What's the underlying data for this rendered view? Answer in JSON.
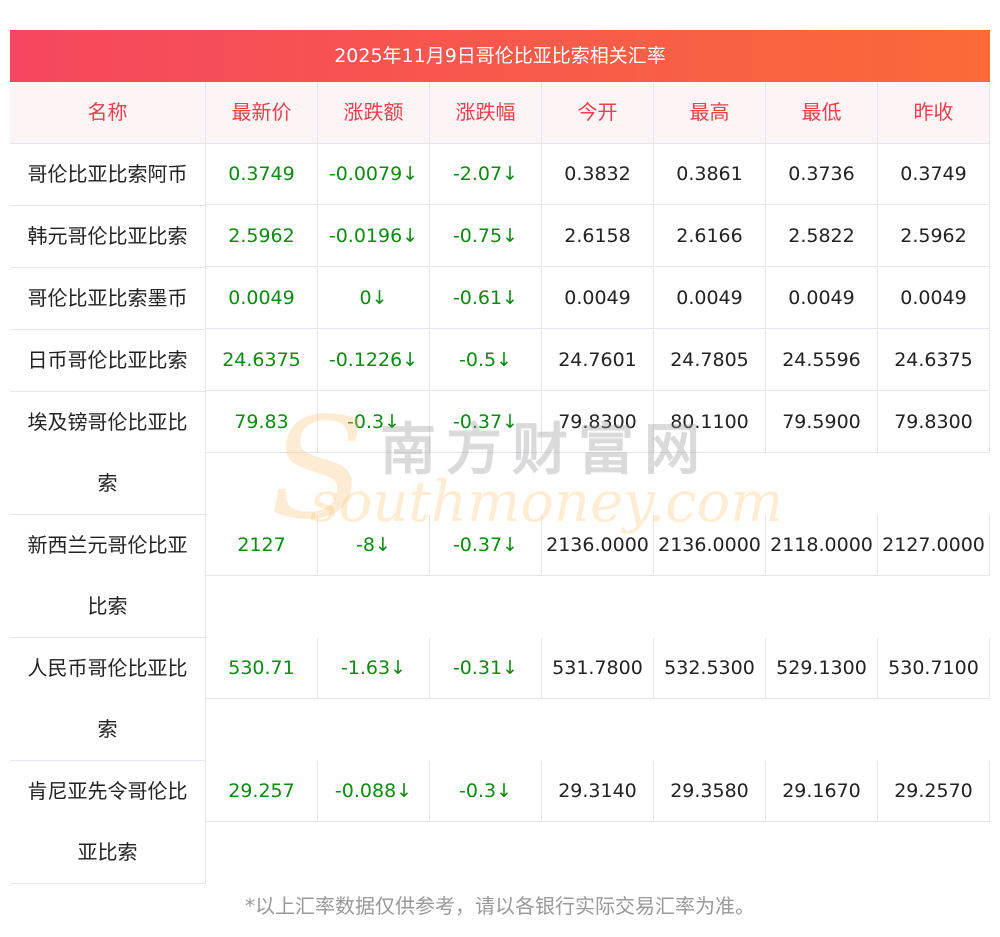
{
  "title": "2025年11月9日哥伦比亚比索相关汇率",
  "headers": [
    "名称",
    "最新价",
    "涨跌额",
    "涨跌幅",
    "今开",
    "最高",
    "最低",
    "昨收"
  ],
  "rows": [
    {
      "name": "哥伦比亚比索阿币",
      "latest": "0.3749",
      "change": "-0.0079↓",
      "pct": "-2.07↓",
      "open": "0.3832",
      "high": "0.3861",
      "low": "0.3736",
      "prev": "0.3749"
    },
    {
      "name": "韩元哥伦比亚比索",
      "latest": "2.5962",
      "change": "-0.0196↓",
      "pct": "-0.75↓",
      "open": "2.6158",
      "high": "2.6166",
      "low": "2.5822",
      "prev": "2.5962"
    },
    {
      "name": "哥伦比亚比索墨币",
      "latest": "0.0049",
      "change": "0↓",
      "pct": "-0.61↓",
      "open": "0.0049",
      "high": "0.0049",
      "low": "0.0049",
      "prev": "0.0049"
    },
    {
      "name": "日币哥伦比亚比索",
      "latest": "24.6375",
      "change": "-0.1226↓",
      "pct": "-0.5↓",
      "open": "24.7601",
      "high": "24.7805",
      "low": "24.5596",
      "prev": "24.6375"
    },
    {
      "name": "埃及镑哥伦比亚比索",
      "latest": "79.83",
      "change": "-0.3↓",
      "pct": "-0.37↓",
      "open": "79.8300",
      "high": "80.1100",
      "low": "79.5900",
      "prev": "79.8300"
    },
    {
      "name": "新西兰元哥伦比亚比索",
      "latest": "2127",
      "change": "-8↓",
      "pct": "-0.37↓",
      "open": "2136.0000",
      "high": "2136.0000",
      "low": "2118.0000",
      "prev": "2127.0000"
    },
    {
      "name": "人民币哥伦比亚比索",
      "latest": "530.71",
      "change": "-1.63↓",
      "pct": "-0.31↓",
      "open": "531.7800",
      "high": "532.5300",
      "low": "529.1300",
      "prev": "530.7100"
    },
    {
      "name": "肯尼亚先令哥伦比亚比索",
      "latest": "29.257",
      "change": "-0.088↓",
      "pct": "-0.3↓",
      "open": "29.3140",
      "high": "29.3580",
      "low": "29.1670",
      "prev": "29.2570"
    }
  ],
  "watermark": {
    "cn": "南方财富网",
    "en": "southmoney.com"
  },
  "note": "*以上汇率数据仅供参考，请以各银行实际交易汇率为准。",
  "colors": {
    "up_down": "#0d8a12",
    "header_text": "#e8404f"
  }
}
